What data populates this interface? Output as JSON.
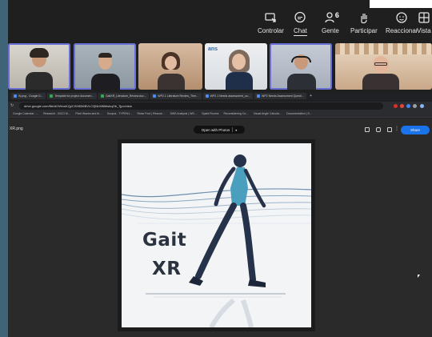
{
  "toolbar": {
    "items": [
      {
        "label": "Controlar",
        "icon": "share-screen-icon"
      },
      {
        "label": "Chat",
        "icon": "chat-icon"
      },
      {
        "label": "Gente",
        "icon": "people-icon",
        "count": "6"
      },
      {
        "label": "Participar",
        "icon": "raise-hand-icon"
      },
      {
        "label": "Reaccionar",
        "icon": "smiley-icon"
      },
      {
        "label": "Vista",
        "icon": "view-grid-icon"
      }
    ]
  },
  "participants": {
    "tile5_org_label": "ans"
  },
  "browser": {
    "tabs": [
      "W.png - Google D…",
      "Template for project documen…",
      "GaitXR_Literature_Review.doc…",
      "WP2.1 Literature Review_Ther…",
      "WP2.1 Needs assessment_ca…",
      "WP2 Needs Assessment Questi…"
    ],
    "url": "drive.google.com/file/d/1WvwKQyCXH8D6BVLC2jNLW6MwhqOb_7jpo/view",
    "bookmarks": [
      "Google Calendar -…",
      "Research - INCO M…",
      "Pixel Waves and th…",
      "Scopus - TYPEN1…",
      "Rwse Font | Rescue…",
      "SWS Analysis | WS…",
      "Spark Rooms",
      "Reconsidering Co…",
      "Visual Angle Calcula…",
      "Documentation | S…"
    ]
  },
  "viewer": {
    "file_name": "XR.png",
    "open_with": "Open with Photos",
    "share": "Share",
    "icons": [
      "add-to-drive-icon",
      "comment-icon",
      "print-icon",
      "more-icon"
    ]
  },
  "image": {
    "line1": "Gait",
    "line2": "XR"
  },
  "colors": {
    "accent": "#1a73e8",
    "selected_tile": "#6a6fd6",
    "logo_text": "#2b3340",
    "shirt": "#4a9fbf"
  }
}
